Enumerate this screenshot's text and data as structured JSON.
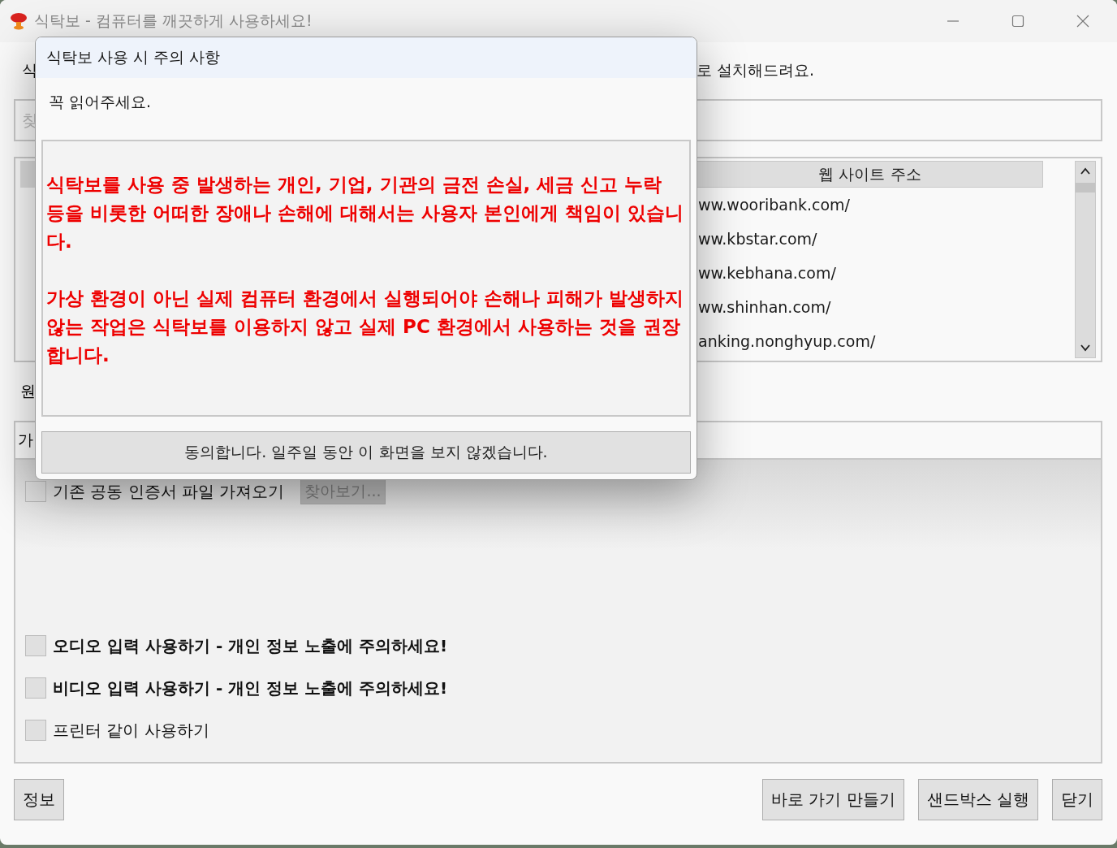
{
  "window": {
    "title": "식탁보 - 컴퓨터를 깨끗하게 사용하세요!"
  },
  "intro": {
    "left_fragment": "식",
    "right_fragment": "로 설치해드려요."
  },
  "search": {
    "placeholder": "찾"
  },
  "site_list": {
    "column_header": "웹 사이트 주소",
    "rows": [
      "ww.wooribank.com/",
      "ww.kbstar.com/",
      "ww.kebhana.com/",
      "ww.shinhan.com/",
      "anking.nonghyup.com/"
    ]
  },
  "options_label_fragment": "원",
  "options": {
    "tab_fragment": "가",
    "items": [
      {
        "label": "기존 공동 인증서 파일 가져오기",
        "checked": false,
        "bold": false,
        "button": {
          "label": "찾아보기...",
          "disabled": true
        }
      },
      {
        "label": "오디오 입력 사용하기 - 개인 정보 노출에 주의하세요!",
        "checked": false,
        "bold": true
      },
      {
        "label": "비디오 입력 사용하기 - 개인 정보 노출에 주의하세요!",
        "checked": false,
        "bold": true
      },
      {
        "label": "프린터 같이 사용하기",
        "checked": false,
        "bold": false
      }
    ]
  },
  "buttons_left": [
    "정보"
  ],
  "buttons_right": [
    "바로 가기 만들기",
    "샌드박스 실행",
    "닫기"
  ],
  "dialog": {
    "title": "식탁보 사용 시 주의 사항",
    "subtitle": "꼭 읽어주세요.",
    "paragraphs": [
      "식탁보를 사용 중 발생하는 개인, 기업, 기관의 금전 손실, 세금 신고 누락 등을 비롯한 어떠한 장애나 손해에 대해서는 사용자 본인에게 책임이 있습니다.",
      "가상 환경이 아닌 실제 컴퓨터 환경에서 실행되어야 손해나 피해가 발생하지 않는 작업은 식탁보를 이용하지 않고 실제 PC 환경에서 사용하는 것을 권장합니다."
    ],
    "agree_button": "동의합니다. 일주일 동안 이 화면을 보지 않겠습니다."
  }
}
